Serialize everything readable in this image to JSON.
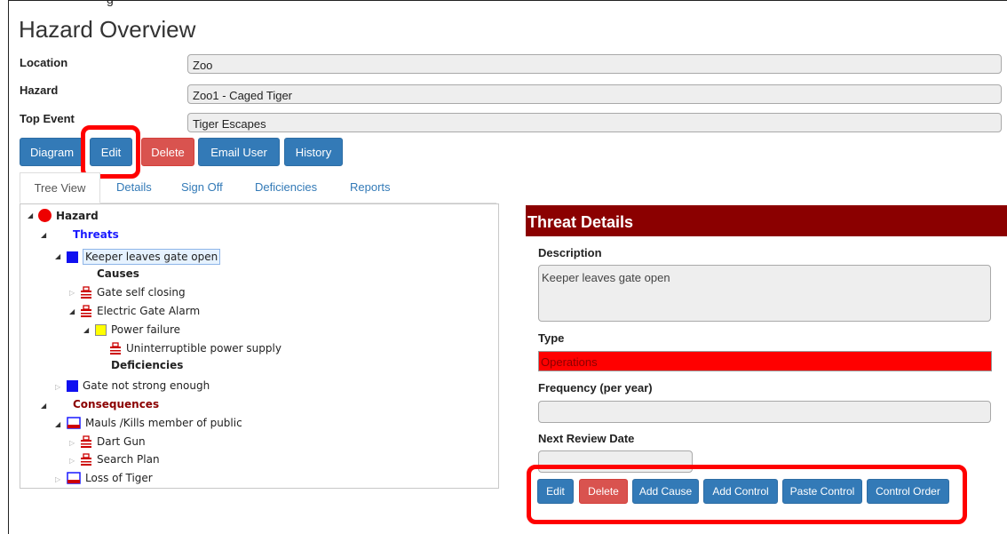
{
  "top_clip_text": "g",
  "page_title": "Hazard Overview",
  "fields": {
    "location_label": "Location",
    "location_value": "Zoo",
    "hazard_label": "Hazard",
    "hazard_value": "Zoo1 - Caged Tiger",
    "top_event_label": "Top Event",
    "top_event_value": "Tiger Escapes"
  },
  "toolbar": {
    "diagram": "Diagram",
    "edit": "Edit",
    "delete": "Delete",
    "email_user": "Email User",
    "history": "History"
  },
  "tabs": {
    "tree_view": "Tree View",
    "details": "Details",
    "sign_off": "Sign Off",
    "deficiencies": "Deficiencies",
    "reports": "Reports"
  },
  "tree": {
    "hazard": "Hazard",
    "threats": "Threats",
    "threat1": "Keeper leaves gate open",
    "causes": "Causes",
    "gate_self_closing": "Gate self closing",
    "electric_gate_alarm": "Electric Gate Alarm",
    "power_failure": "Power failure",
    "ups": "Uninterruptible power supply",
    "deficiencies": "Deficiencies",
    "threat2": "Gate not strong enough",
    "consequences": "Consequences",
    "cons1": "Mauls /Kills member of public",
    "dart_gun": "Dart Gun",
    "search_plan": "Search Plan",
    "cons2": "Loss of Tiger"
  },
  "details": {
    "header": "Threat Details",
    "description_label": "Description",
    "description_value": "Keeper leaves gate open",
    "type_label": "Type",
    "type_value": "Operations",
    "frequency_label": "Frequency (per year)",
    "frequency_value": "",
    "review_label": "Next Review Date",
    "review_value": ""
  },
  "detail_buttons": {
    "edit": "Edit",
    "delete": "Delete",
    "add_cause": "Add Cause",
    "add_control": "Add Control",
    "paste_control": "Paste Control",
    "control_order": "Control Order"
  },
  "colors": {
    "primary": "#337ab7",
    "danger": "#d9534f",
    "header": "#8b0000",
    "type_fill": "#ff0000",
    "highlight": "#ff0000"
  }
}
